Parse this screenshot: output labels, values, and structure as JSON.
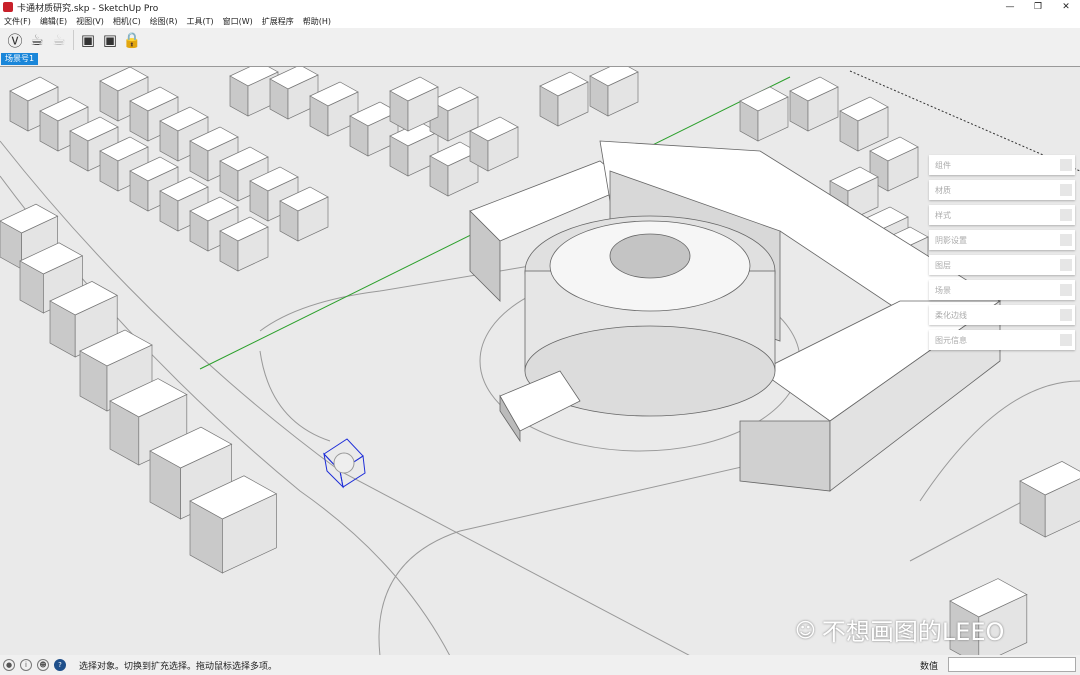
{
  "window": {
    "title": "卡通材质研究.skp - SketchUp Pro",
    "controls": [
      "—",
      "❐",
      "✕"
    ]
  },
  "menu": [
    "文件(F)",
    "编辑(E)",
    "视图(V)",
    "相机(C)",
    "绘图(R)",
    "工具(T)",
    "窗口(W)",
    "扩展程序",
    "帮助(H)"
  ],
  "toolbar": {
    "icons": [
      "vray-logo-icon",
      "teapot-render-icon",
      "teapot-interactive-icon",
      "frame-buffer-icon",
      "render-window-icon",
      "lock-icon"
    ]
  },
  "scene_tab": "场景号1",
  "tray": [
    "组件",
    "材质",
    "样式",
    "阴影设置",
    "图层",
    "场景",
    "柔化边线",
    "图元信息"
  ],
  "watermark": "不想画图的LEEO",
  "status": {
    "text": "选择对象。切换到扩充选择。拖动鼠标选择多项。",
    "measure_label": "数值",
    "measure_value": ""
  },
  "colors": {
    "accent": "#1a86d9",
    "axis_green": "#2ca02c",
    "selection": "#1e2ed8"
  }
}
